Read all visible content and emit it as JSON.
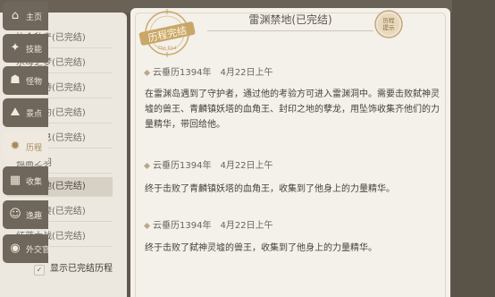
{
  "quest_list": {
    "items": [
      {
        "label": "协会私产(已完结)",
        "active": false
      },
      {
        "label": "水母之梦(已完结)",
        "active": false
      },
      {
        "label": "天空之诗(已完结)",
        "active": false
      },
      {
        "label": "曾时之约(已完结)",
        "active": false
      },
      {
        "label": "生生不息(已完结)",
        "active": false
      },
      {
        "label": "孤高之羽",
        "active": false
      },
      {
        "label": "雷渊禁地(已完结)",
        "active": true
      },
      {
        "label": "妙絮夫妻(已完结)",
        "active": false
      },
      {
        "label": "红蓝大战(已完结)",
        "active": false
      }
    ],
    "show_completed_checkbox": "✓",
    "show_completed_label": "显示已完结历程"
  },
  "main": {
    "badge_left_text": "历程完结",
    "badge_left_sub": "The End",
    "badge_right_text": "历程提示",
    "title": "雷渊禁地(已完结)",
    "entries": [
      {
        "calendar": "云垂历1394年",
        "date": "4月22日上午",
        "text": "在雷渊岛遇到了守护者，通过他的考验方可进入雷渊洞中。需要击败弑神灵墟的兽王、青麟镇妖塔的血角王、封印之地的孽龙，用坠饰收集齐他们的力量精华，带回给他。"
      },
      {
        "calendar": "云垂历1394年",
        "date": "4月22日上午",
        "text": "终于击败了青麟镇妖塔的血角王，收集到了他身上的力量精华。"
      },
      {
        "calendar": "云垂历1394年",
        "date": "4月22日上午",
        "text": "终于击败了弑神灵墟的兽王，收集到了他身上的力量精华。"
      }
    ]
  },
  "right_nav": {
    "items": [
      {
        "label": "主页",
        "icon": "home-icon",
        "glyph": "⌂",
        "active": false
      },
      {
        "label": "技能",
        "icon": "skill-icon",
        "glyph": "✦",
        "active": false
      },
      {
        "label": "怪物",
        "icon": "monster-icon",
        "glyph": "☗",
        "active": false
      },
      {
        "label": "景点",
        "icon": "scenery-icon",
        "glyph": "⛰",
        "active": false
      },
      {
        "label": "历程",
        "icon": "journey-icon",
        "glyph": "✹",
        "active": true
      },
      {
        "label": "收集",
        "icon": "collect-icon",
        "glyph": "▦",
        "active": false
      },
      {
        "label": "逸趣",
        "icon": "fun-icon",
        "glyph": "☺",
        "active": false
      },
      {
        "label": "外交官",
        "icon": "diplomat-icon",
        "glyph": "◉",
        "active": false
      }
    ]
  }
}
